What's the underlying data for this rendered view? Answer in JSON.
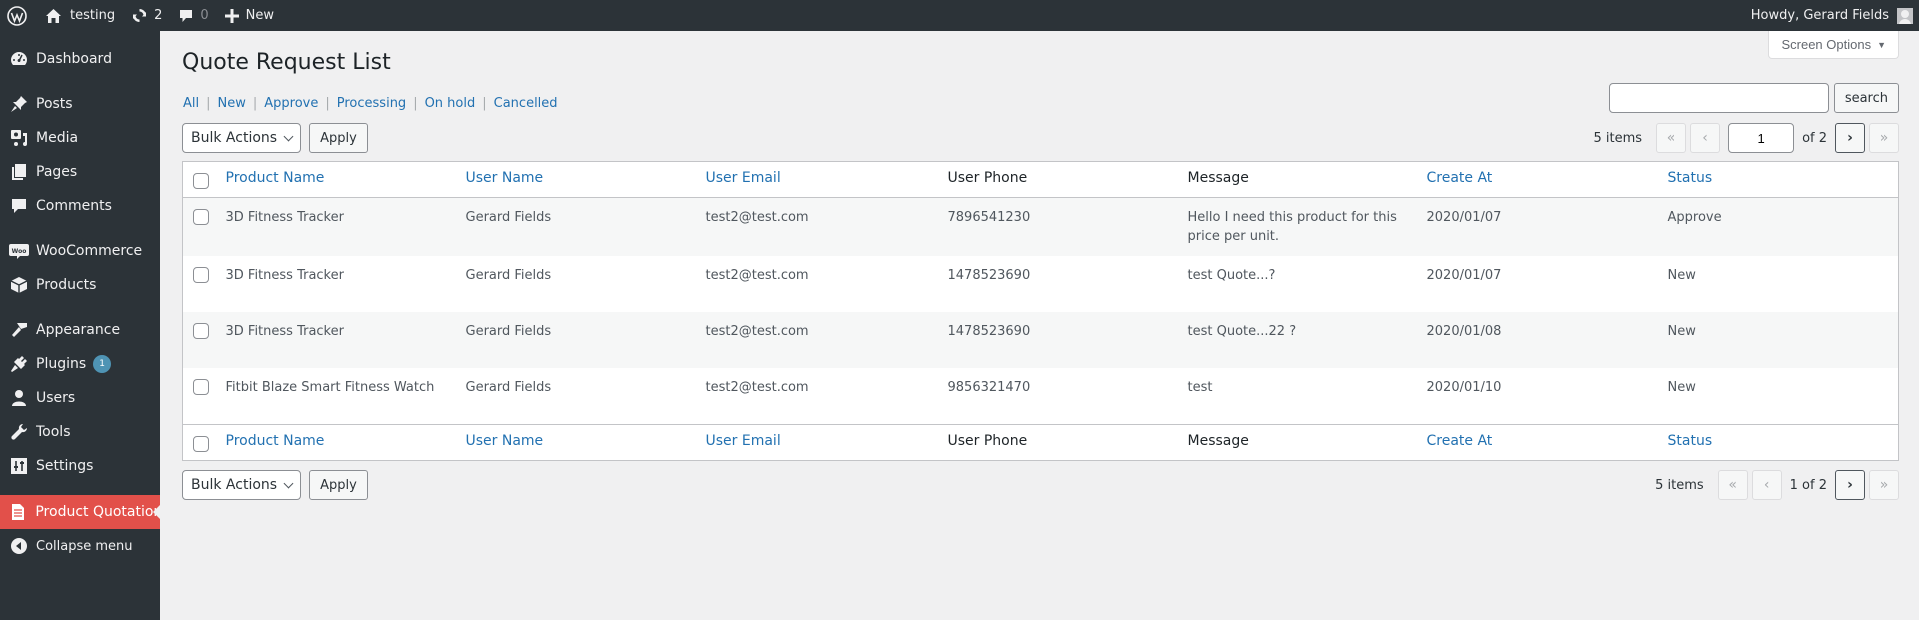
{
  "adminbar": {
    "site_name": "testing",
    "updates_count": "2",
    "comments_count": "0",
    "new_label": "New",
    "greeting": "Howdy, Gerard Fields"
  },
  "sidebar": {
    "items": [
      {
        "label": "Dashboard",
        "icon": "dashboard-icon"
      },
      {
        "label": "Posts",
        "icon": "pin-icon"
      },
      {
        "label": "Media",
        "icon": "media-icon"
      },
      {
        "label": "Pages",
        "icon": "pages-icon"
      },
      {
        "label": "Comments",
        "icon": "comment-icon"
      },
      {
        "label": "WooCommerce",
        "icon": "woocommerce-icon"
      },
      {
        "label": "Products",
        "icon": "box-icon"
      },
      {
        "label": "Appearance",
        "icon": "brush-icon"
      },
      {
        "label": "Plugins",
        "icon": "plug-icon",
        "badge": "1"
      },
      {
        "label": "Users",
        "icon": "user-icon"
      },
      {
        "label": "Tools",
        "icon": "wrench-icon"
      },
      {
        "label": "Settings",
        "icon": "sliders-icon"
      },
      {
        "label": "Product Quotation",
        "icon": "document-icon",
        "active": true
      },
      {
        "label": "Collapse menu",
        "icon": "collapse-icon"
      }
    ]
  },
  "screen_options": {
    "label": "Screen Options"
  },
  "page": {
    "title": "Quote Request List",
    "filters": [
      "All",
      "New",
      "Approve",
      "Processing",
      "On hold",
      "Cancelled"
    ]
  },
  "search": {
    "value": "",
    "button_label": "search"
  },
  "tablenav_top": {
    "bulk_actions": "Bulk Actions",
    "apply_label": "Apply",
    "items_count": "5 items",
    "first": "«",
    "prev": "‹",
    "current_page": "1",
    "of_total": "of 2",
    "next": "›",
    "last": "»"
  },
  "tablenav_bottom": {
    "bulk_actions": "Bulk Actions",
    "apply_label": "Apply",
    "items_count": "5 items",
    "first": "«",
    "prev": "‹",
    "page_text": "1 of 2",
    "next": "›",
    "last": "»"
  },
  "table": {
    "columns": [
      {
        "label": "Product Name",
        "sortable": true
      },
      {
        "label": "User Name",
        "sortable": true
      },
      {
        "label": "User Email",
        "sortable": true
      },
      {
        "label": "User Phone",
        "sortable": false
      },
      {
        "label": "Message",
        "sortable": false
      },
      {
        "label": "Create At",
        "sortable": true
      },
      {
        "label": "Status",
        "sortable": true
      }
    ],
    "rows": [
      [
        "3D Fitness Tracker",
        "Gerard Fields",
        "test2@test.com",
        "7896541230",
        "Hello I need this product for this price per unit.",
        "2020/01/07",
        "Approve"
      ],
      [
        "3D Fitness Tracker",
        "Gerard Fields",
        "test2@test.com",
        "1478523690",
        "test Quote...?",
        "2020/01/07",
        "New"
      ],
      [
        "3D Fitness Tracker",
        "Gerard Fields",
        "test2@test.com",
        "1478523690",
        "test Quote...22 ?",
        "2020/01/08",
        "New"
      ],
      [
        "Fitbit Blaze Smart Fitness Watch",
        "Gerard Fields",
        "test2@test.com",
        "9856321470",
        "test",
        "2020/01/10",
        "New"
      ]
    ]
  },
  "colors": {
    "accent_link": "#2271b1",
    "sidebar_bg": "#2c3338",
    "active_menu": "#e2504a",
    "background": "#f0f0f1"
  }
}
